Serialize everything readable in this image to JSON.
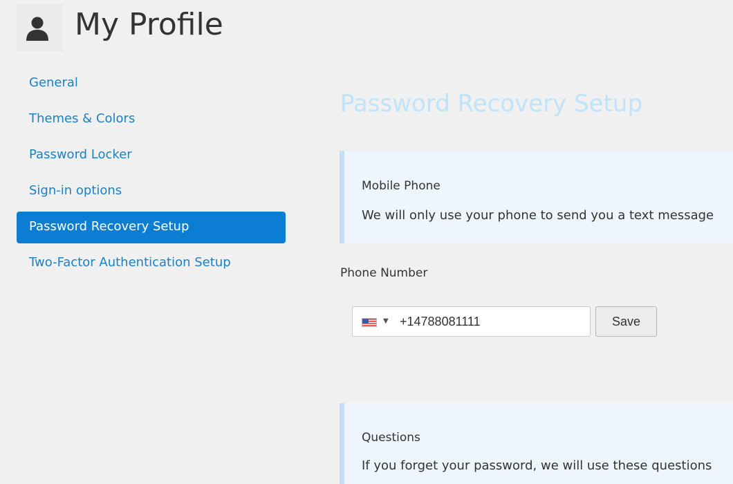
{
  "header": {
    "icon": "user-icon",
    "title": "My Profile"
  },
  "sidebar": {
    "items": [
      {
        "label": "General",
        "active": false
      },
      {
        "label": "Themes & Colors",
        "active": false
      },
      {
        "label": "Password Locker",
        "active": false
      },
      {
        "label": "Sign-in options",
        "active": false
      },
      {
        "label": "Password Recovery Setup",
        "active": true
      },
      {
        "label": "Two-Factor Authentication Setup",
        "active": false
      }
    ]
  },
  "main": {
    "section_title": "Password Recovery Setup",
    "mobile_box": {
      "heading": "Mobile Phone",
      "text": "We will only use your phone to send you a text message"
    },
    "phone": {
      "label": "Phone Number",
      "country_flag": "us-flag-icon",
      "value": "+14788081111",
      "save_label": "Save"
    },
    "questions_box": {
      "heading": "Questions",
      "text": "If you forget your password, we will use these questions"
    }
  },
  "colors": {
    "accent": "#0b7dd2",
    "link": "#1c80c4",
    "section_title": "#bfe3f8",
    "info_box_bg": "#eef5fd",
    "info_box_border": "#c8def2",
    "page_bg": "#f0f0f0"
  }
}
